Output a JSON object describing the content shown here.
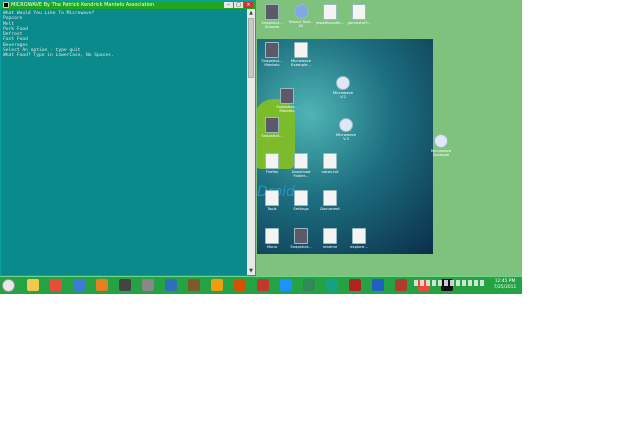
{
  "console": {
    "title": "MICROWAVE By The Patrick Kendrick Mantelo Association",
    "lines": [
      "What Would You Like To Microwave?",
      "Popcorn",
      "Melt",
      "Pork Food",
      "Defrost",
      "Fast Food",
      "Beverages",
      "Select An option - type quit",
      "What Food? Type in LowerCase, No Spaces."
    ]
  },
  "desktop_icons": [
    {
      "label": "Snapshot...\nSnazzia",
      "kind": "photo"
    },
    {
      "label": "Yahoo! Tool...\n02",
      "kind": "globe"
    },
    {
      "label": "jewelfounder...",
      "kind": "doc"
    },
    {
      "label": "gamestuff...",
      "kind": "doc"
    },
    {
      "label": "Snapshot...\nMantelo",
      "kind": "photo"
    },
    {
      "label": "Microwave\nExample...",
      "kind": "doc"
    },
    {
      "label": "Snapshot...\nMantelo",
      "kind": "photo"
    },
    {
      "label": "Microwave\nV.2",
      "kind": "magn"
    },
    {
      "label": "Snapshot...",
      "kind": "photo"
    },
    {
      "label": "Microwave\nV.3",
      "kind": "magn"
    },
    {
      "label": "Microwave\nExample",
      "kind": "magn"
    },
    {
      "label": "Firefox",
      "kind": "doc"
    },
    {
      "label": "Download\nFolder...",
      "kind": "doc"
    },
    {
      "label": "notes.txt",
      "kind": "doc"
    },
    {
      "label": "Tools",
      "kind": "doc"
    },
    {
      "label": "Settings",
      "kind": "doc"
    },
    {
      "label": "Document",
      "kind": "doc"
    },
    {
      "label": "Mono",
      "kind": "doc"
    },
    {
      "label": "Snapshot...",
      "kind": "photo"
    },
    {
      "label": "readme",
      "kind": "doc"
    },
    {
      "label": "explore...",
      "kind": "doc"
    }
  ],
  "wallpaper": {
    "text": "Droid"
  },
  "taskbar": {
    "items": [
      "start",
      "explorer",
      "chrome",
      "ie",
      "media",
      "task",
      "app1",
      "app2",
      "app3",
      "app4",
      "app5",
      "app6",
      "app7",
      "office",
      "app8",
      "app9",
      "word",
      "app10",
      "chrome2",
      "cmd"
    ],
    "colors": [
      "#e8e8e8",
      "#f2c94c",
      "#e74c3c",
      "#3a7bd5",
      "#e67e22",
      "#444",
      "#888",
      "#2c6fbb",
      "#7d5a2a",
      "#f39c12",
      "#d35400",
      "#c0392b",
      "#1e90ff",
      "#2e8b57",
      "#16a085",
      "#b22222",
      "#1f5fbf",
      "#b03a2e",
      "#e74c3c",
      "#111"
    ],
    "clock_time": "12:45 PM",
    "clock_date": "7/25/2011"
  }
}
